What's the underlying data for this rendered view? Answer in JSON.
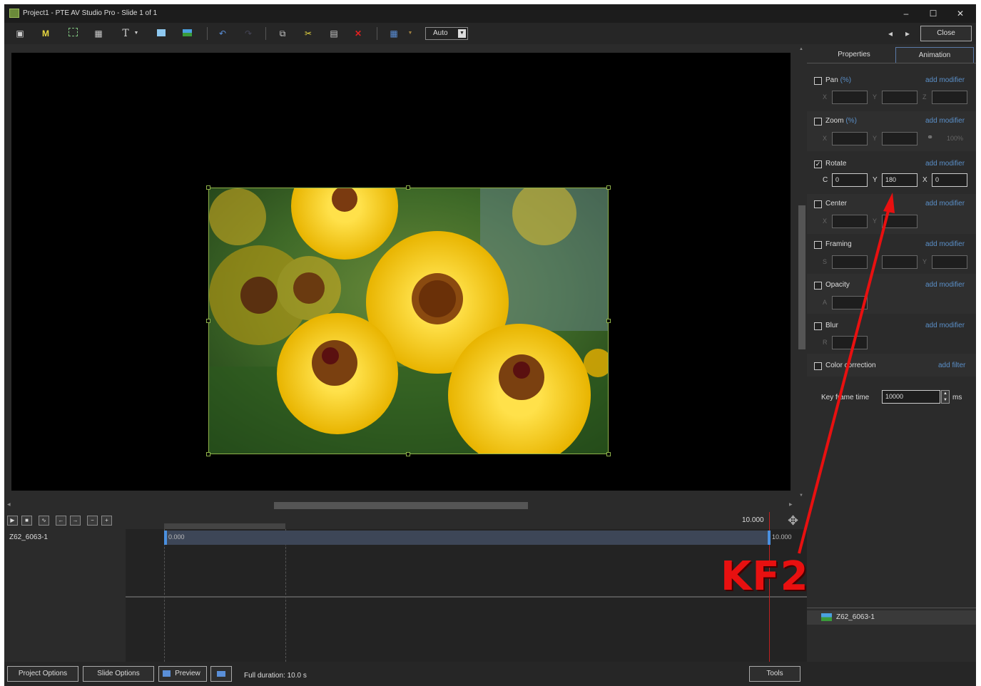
{
  "window": {
    "title": "Project1 - PTE AV Studio Pro - Slide 1 of 1",
    "controls": {
      "minimize": "–",
      "maximize": "☐",
      "close": "✕"
    }
  },
  "toolbar": {
    "icons": [
      "slideshow-icon",
      "m-icon",
      "frame-icon",
      "image-icon",
      "text-icon",
      "dropdown-icon",
      "rectangle-icon",
      "landscape-icon",
      "undo-icon",
      "redo-icon",
      "copy-icon",
      "cut-icon",
      "paste-icon",
      "delete-icon",
      "grid-icon",
      "dropdown-icon"
    ],
    "auto_select": "Auto",
    "nav_prev": "◂",
    "nav_next": "▸",
    "close_label": "Close"
  },
  "right_panel": {
    "tabs": [
      "Properties",
      "Animation"
    ],
    "active_tab": "Animation",
    "sections": {
      "pan": {
        "label": "Pan",
        "unit": "(%)",
        "checked": false,
        "action": "add modifier",
        "axes": [
          "X",
          "Y",
          "Z"
        ]
      },
      "zoom": {
        "label": "Zoom",
        "unit": "(%)",
        "checked": false,
        "action": "add modifier",
        "axes": [
          "X",
          "Y"
        ],
        "link_value": "100%"
      },
      "rotate": {
        "label": "Rotate",
        "checked": true,
        "action": "add modifier",
        "axes": [
          "C",
          "Y",
          "X"
        ],
        "values": [
          "0",
          "180",
          "0"
        ]
      },
      "center": {
        "label": "Center",
        "checked": false,
        "action": "add modifier",
        "axes": [
          "X",
          "Y"
        ]
      },
      "framing": {
        "label": "Framing",
        "checked": false,
        "action": "add modifier",
        "axes": [
          "S",
          "",
          "Y"
        ]
      },
      "opacity": {
        "label": "Opacity",
        "checked": false,
        "action": "add modifier",
        "axes": [
          "A"
        ]
      },
      "blur": {
        "label": "Blur",
        "checked": false,
        "action": "add modifier",
        "axes": [
          "R"
        ]
      },
      "color_correction": {
        "label": "Color correction",
        "checked": false,
        "action": "add filter"
      }
    },
    "key_frame_time": {
      "label": "Key frame time",
      "value": "10000",
      "unit": "ms"
    },
    "object_list": [
      {
        "name": "Z62_6063-1",
        "icon": "image-icon"
      }
    ]
  },
  "timeline": {
    "controls": [
      "▶",
      "■",
      "∿",
      "←",
      "→",
      "−",
      "+"
    ],
    "end_time_label": "10.000",
    "track": {
      "name": "Z62_6063-1",
      "keyframes": [
        "0.000",
        "10.000"
      ]
    }
  },
  "bottom_bar": {
    "project_options": "Project Options",
    "slide_options": "Slide Options",
    "preview": "Preview",
    "full_duration": "Full duration: 10.0 s",
    "tools": "Tools"
  },
  "annotation": {
    "label": "KF2",
    "color": "#e81010"
  }
}
